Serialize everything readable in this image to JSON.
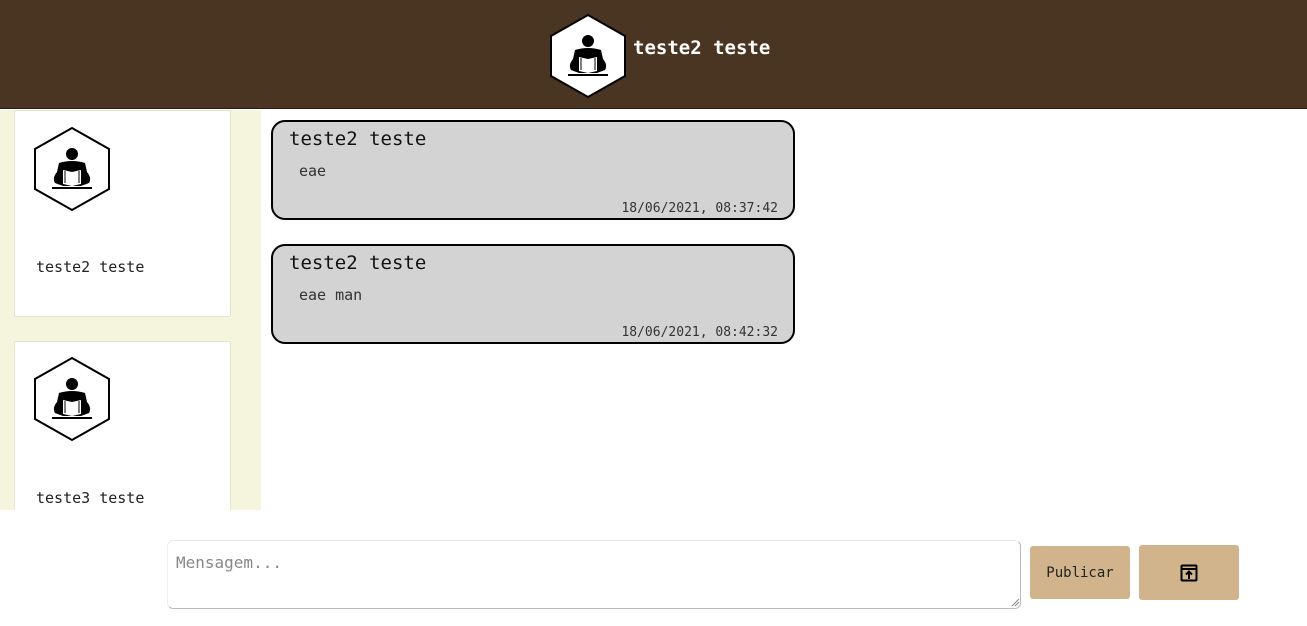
{
  "header": {
    "title": "teste2 teste",
    "avatar_icon": "reader-hexagon-icon",
    "background": "#4a3523"
  },
  "sidebar": {
    "background": "#f5f4dd",
    "contacts": [
      {
        "name": "teste2 teste",
        "avatar_icon": "reader-hexagon-icon"
      },
      {
        "name": "teste3 teste",
        "avatar_icon": "reader-hexagon-icon"
      }
    ]
  },
  "messages": [
    {
      "author": "teste2 teste",
      "text": "eae",
      "time": "18/06/2021, 08:37:42"
    },
    {
      "author": "teste2 teste",
      "text": "eae man",
      "time": "18/06/2021, 08:42:32"
    }
  ],
  "composer": {
    "placeholder": "Mensagem...",
    "value": "",
    "publish_label": "Publicar",
    "attach_icon": "open-in-new-icon",
    "button_color": "#d2b48c"
  }
}
